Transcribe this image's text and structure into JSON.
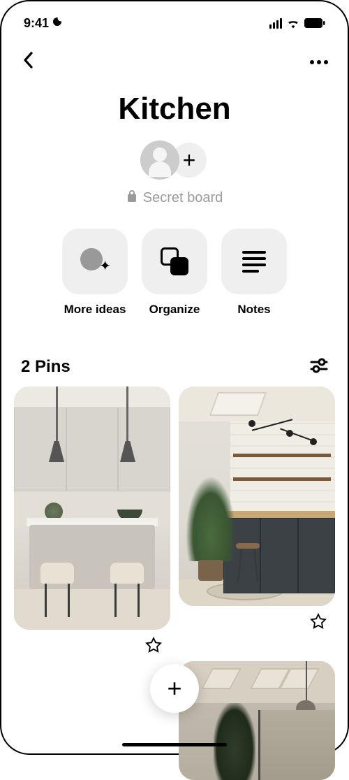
{
  "status": {
    "time": "9:41"
  },
  "board": {
    "title": "Kitchen",
    "secret_label": "Secret board",
    "pins_count_label": "2 Pins"
  },
  "actions": {
    "more_ideas": "More ideas",
    "organize": "Organize",
    "notes": "Notes"
  },
  "fab": {
    "plus": "+"
  },
  "add": {
    "plus": "+"
  }
}
